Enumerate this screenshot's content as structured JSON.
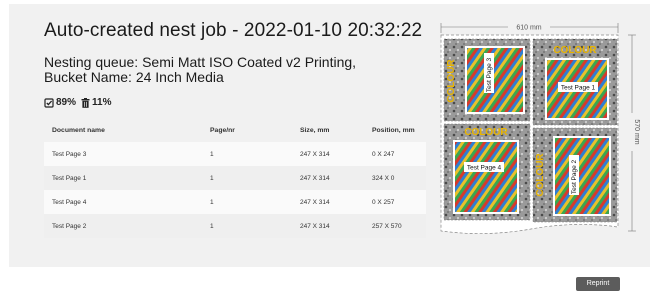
{
  "job": {
    "title": "Auto-created nest job - 2022-01-10 20:32:22",
    "queue_line": "Nesting queue: Semi Matt ISO Coated v2 Printing,",
    "bucket_line": "Bucket Name: 24 Inch Media",
    "utilization": "89%",
    "waste": "11%"
  },
  "table": {
    "headers": [
      "Document name",
      "Page/nr",
      "Size, mm",
      "Position, mm"
    ],
    "rows": [
      {
        "name": "Test Page 3",
        "page": "1",
        "size": "247 X 314",
        "position": "0 X 247"
      },
      {
        "name": "Test Page 1",
        "page": "1",
        "size": "247 X 314",
        "position": "324 X 0"
      },
      {
        "name": "Test Page 4",
        "page": "1",
        "size": "247 X 314",
        "position": "0 X 257"
      },
      {
        "name": "Test Page 2",
        "page": "1",
        "size": "247 X 314",
        "position": "257 X 570"
      }
    ]
  },
  "preview": {
    "width_label": "610 mm",
    "height_label": "570 mm",
    "pages": [
      {
        "label": "Test Page 3",
        "brand": "COLOUR"
      },
      {
        "label": "Test Page 1",
        "brand": "COLOUR"
      },
      {
        "label": "Test Page 4",
        "brand": "COLOUR"
      },
      {
        "label": "Test Page 2",
        "brand": "COLOUR"
      }
    ]
  },
  "buttons": {
    "reprint": "Reprint"
  },
  "colors": {
    "brand_yellow": "#e8b400",
    "panel_bg": "#f1f1f1",
    "button_bg": "#5c5c5c"
  }
}
